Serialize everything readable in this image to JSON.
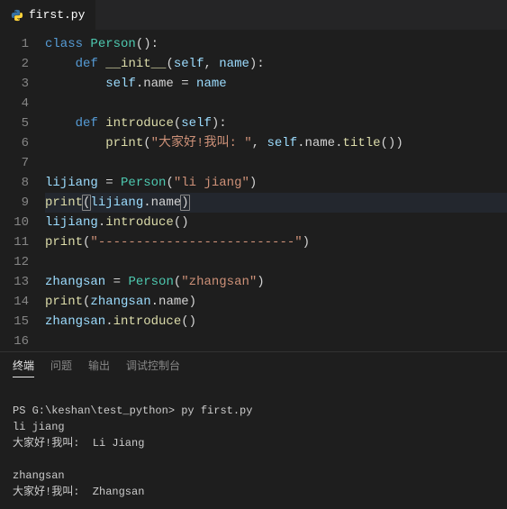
{
  "tab": {
    "filename": "first.py"
  },
  "gutter": [
    "1",
    "2",
    "3",
    "4",
    "5",
    "6",
    "7",
    "8",
    "9",
    "10",
    "11",
    "12",
    "13",
    "14",
    "15",
    "16"
  ],
  "code": {
    "l1": {
      "kw_class": "class",
      "cls": "Person",
      "paren": "():"
    },
    "l2": {
      "kw_def": "def",
      "fn": "__init__",
      "params_open": "(",
      "self": "self",
      "comma": ", ",
      "name": "name",
      "params_close": "):"
    },
    "l3": {
      "self": "self",
      "dot_name": ".name = ",
      "name2": "name"
    },
    "l5": {
      "kw_def": "def",
      "fn": "introduce",
      "params_open": "(",
      "self": "self",
      "params_close": "):"
    },
    "l6": {
      "fn": "print",
      "open": "(",
      "str": "\"大家好!我叫: \"",
      "comma": ", ",
      "self": "self",
      "dot": ".name.",
      "title": "title",
      "close": "())"
    },
    "l8": {
      "var": "lijiang",
      "eq": " = ",
      "cls": "Person",
      "open": "(",
      "str": "\"li jiang\"",
      "close": ")"
    },
    "l9": {
      "fn": "print",
      "open": "(",
      "var": "lijiang",
      "dot": ".name",
      "close": ")"
    },
    "l10": {
      "var": "lijiang",
      "dot": ".",
      "fn": "introduce",
      "call": "()"
    },
    "l11": {
      "fn": "print",
      "open": "(",
      "str": "\"--------------------------\"",
      "close": ")"
    },
    "l13": {
      "var": "zhangsan",
      "eq": " = ",
      "cls": "Person",
      "open": "(",
      "str": "\"zhangsan\"",
      "close": ")"
    },
    "l14": {
      "fn": "print",
      "open": "(",
      "var": "zhangsan",
      "dot": ".name",
      "close": ")"
    },
    "l15": {
      "var": "zhangsan",
      "dot": ".",
      "fn": "introduce",
      "call": "()"
    }
  },
  "panel": {
    "tabs": {
      "terminal": "终端",
      "problems": "问题",
      "output": "输出",
      "debug": "调试控制台"
    }
  },
  "terminal": {
    "prompt": "PS G:\\keshan\\test_python> ",
    "cmd": "py first.py",
    "out1": "li jiang",
    "out2": "大家好!我叫:  Li Jiang",
    "out3": "",
    "out4": "zhangsan",
    "out5": "大家好!我叫:  Zhangsan"
  }
}
